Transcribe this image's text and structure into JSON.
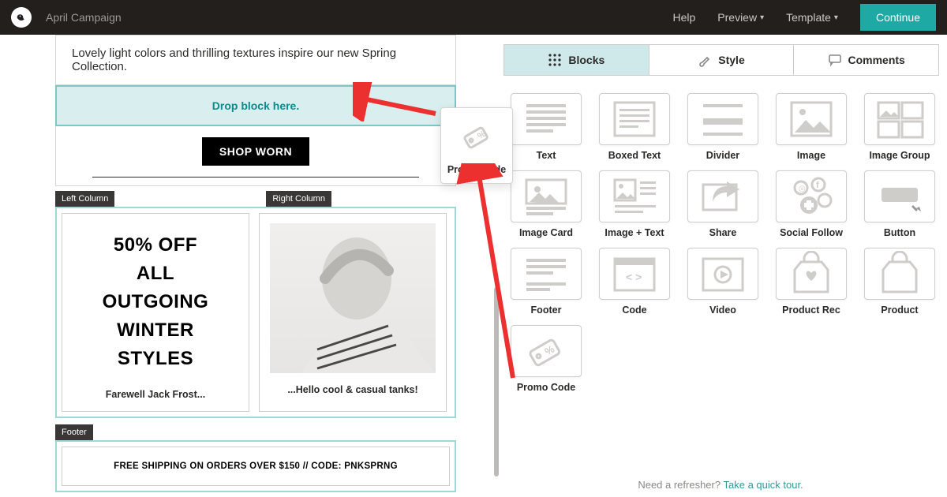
{
  "topbar": {
    "campaign_name": "April Campaign",
    "help": "Help",
    "preview": "Preview",
    "template": "Template",
    "continue": "Continue"
  },
  "editor": {
    "intro": "Lovely light colors and thrilling textures inspire our new Spring Collection.",
    "drop_here": "Drop block here.",
    "shop_btn": "SHOP WORN",
    "left_col_label": "Left Column",
    "right_col_label": "Right Column",
    "promo_lines": [
      "50% OFF",
      "ALL",
      "OUTGOING",
      "WINTER",
      "STYLES"
    ],
    "caption_left": "Farewell Jack Frost...",
    "caption_right": "...Hello cool & casual tanks!",
    "footer_label": "Footer",
    "footer_text": "FREE SHIPPING ON ORDERS OVER $150 // CODE: PNKSPRNG"
  },
  "dragging": {
    "label": "Promo Code"
  },
  "tabs": {
    "blocks": "Blocks",
    "style": "Style",
    "comments": "Comments"
  },
  "blocks": [
    {
      "id": "text",
      "label": "Text"
    },
    {
      "id": "boxed-text",
      "label": "Boxed Text"
    },
    {
      "id": "divider",
      "label": "Divider"
    },
    {
      "id": "image",
      "label": "Image"
    },
    {
      "id": "image-group",
      "label": "Image Group"
    },
    {
      "id": "image-card",
      "label": "Image Card"
    },
    {
      "id": "image-text",
      "label": "Image + Text"
    },
    {
      "id": "share",
      "label": "Share"
    },
    {
      "id": "social-follow",
      "label": "Social Follow"
    },
    {
      "id": "button",
      "label": "Button"
    },
    {
      "id": "footer",
      "label": "Footer"
    },
    {
      "id": "code",
      "label": "Code"
    },
    {
      "id": "video",
      "label": "Video"
    },
    {
      "id": "product-rec",
      "label": "Product Rec"
    },
    {
      "id": "product",
      "label": "Product"
    },
    {
      "id": "promo-code",
      "label": "Promo Code"
    }
  ],
  "refresher": {
    "prefix": "Need a refresher? ",
    "link": "Take a quick tour"
  }
}
